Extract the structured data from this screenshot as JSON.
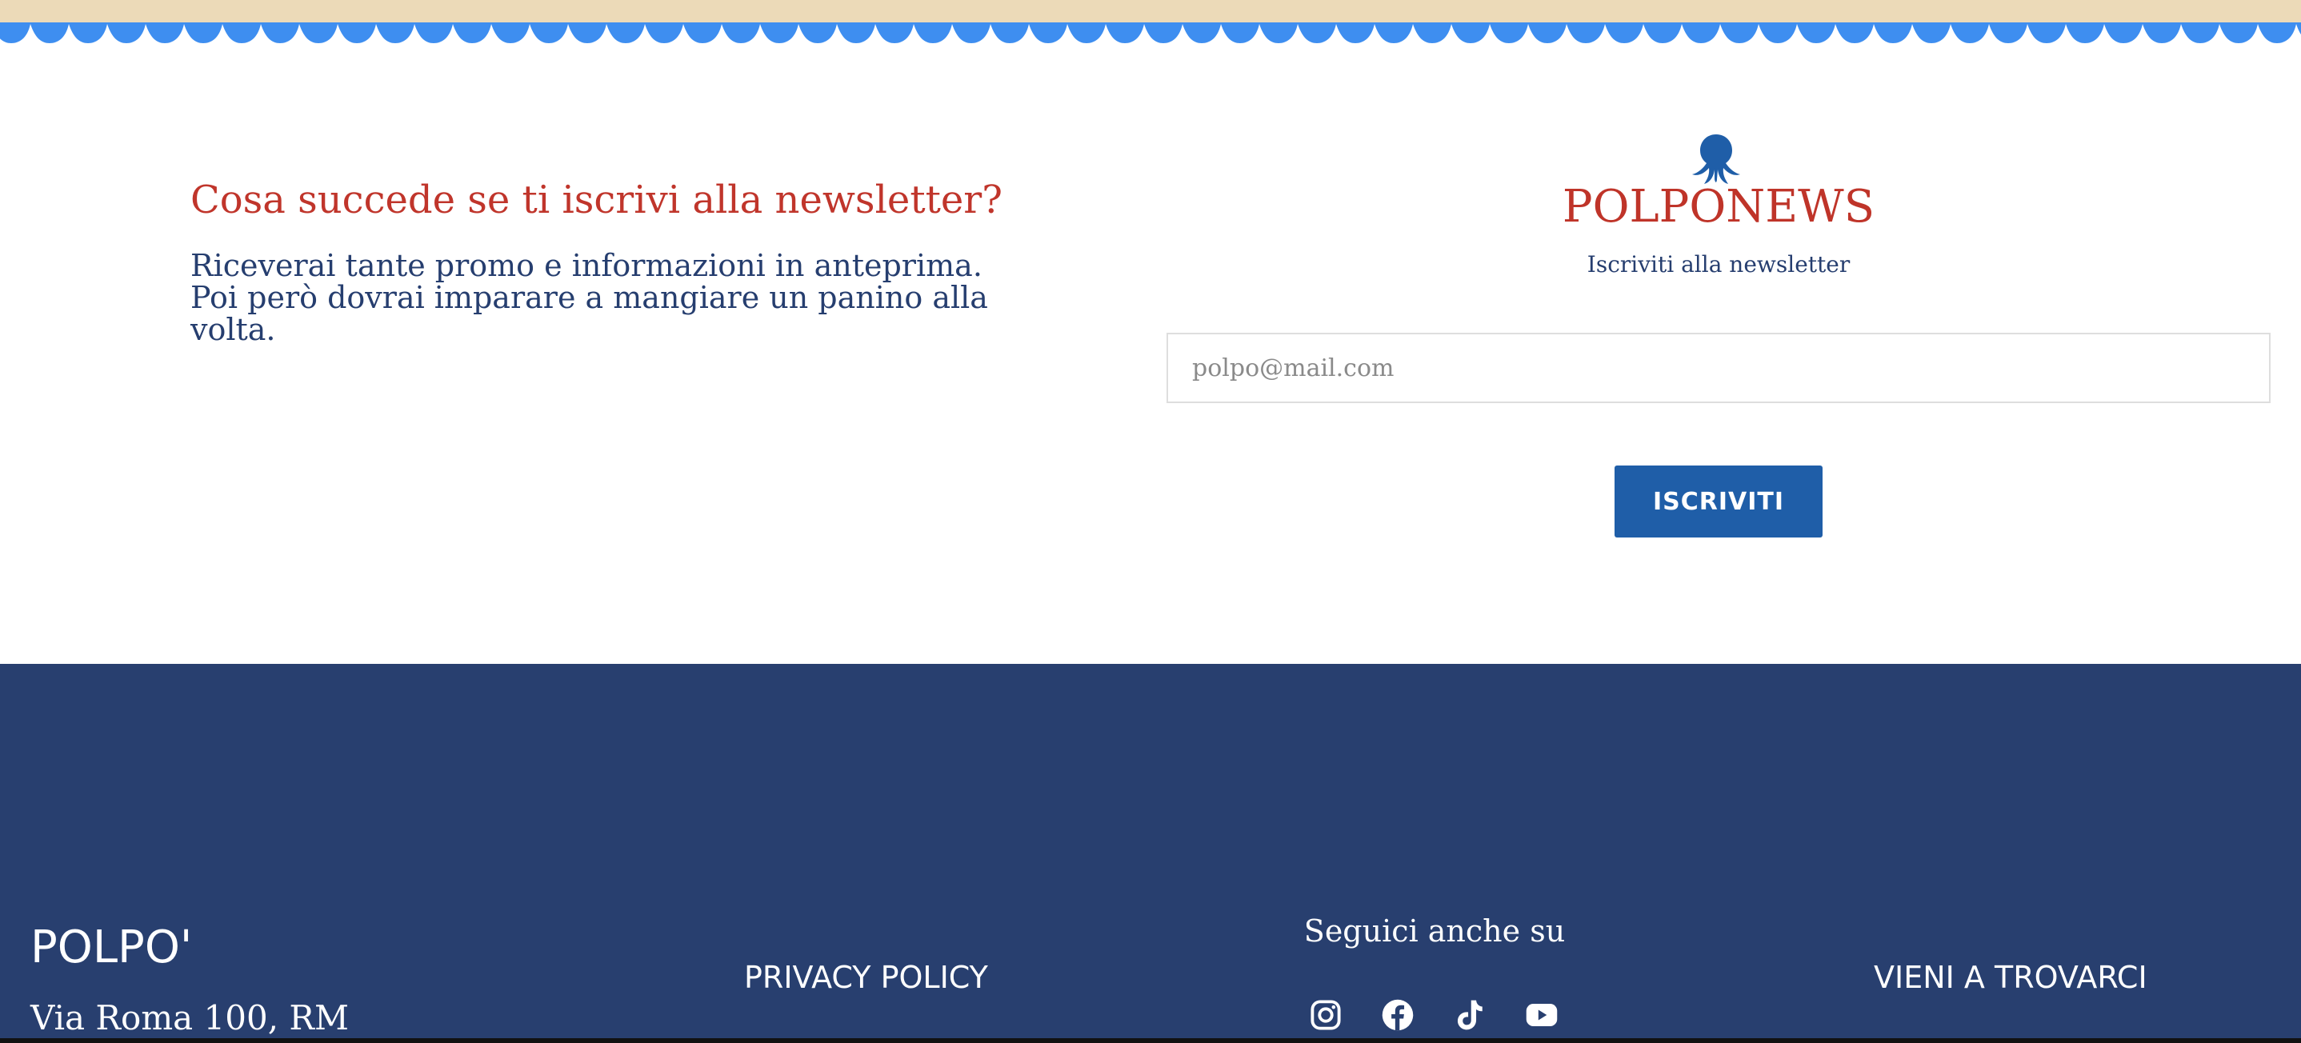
{
  "newsletter": {
    "heading": "Cosa succede se ti iscrivi alla newsletter?",
    "body": "Riceverai tante promo e informazioni in anteprima. Poi però dovrai imparare a mangiare un panino alla volta.",
    "brand_icon": "octopus-icon",
    "brand_title": "POLPONEWS",
    "caption": "Iscriviti alla newsletter",
    "email_placeholder": "polpo@mail.com",
    "email_value": "",
    "submit_label": "ISCRIVITI"
  },
  "footer": {
    "brand": "POLPO'",
    "address": "Via Roma 100, RM",
    "privacy_label": "PRIVACY POLICY",
    "follow_title": "Seguici anche su",
    "social": [
      {
        "icon": "instagram-icon"
      },
      {
        "icon": "facebook-icon"
      },
      {
        "icon": "tiktok-icon"
      },
      {
        "icon": "youtube-icon"
      }
    ],
    "visit_label": "VIENI A TROVARCI"
  },
  "colors": {
    "top_band": "#ecdab8",
    "wave": "#3e8ef0",
    "heading_red": "#c0352b",
    "text_navy": "#263e6f",
    "button_blue": "#1f5ea8",
    "footer_bg": "#283f6f"
  }
}
